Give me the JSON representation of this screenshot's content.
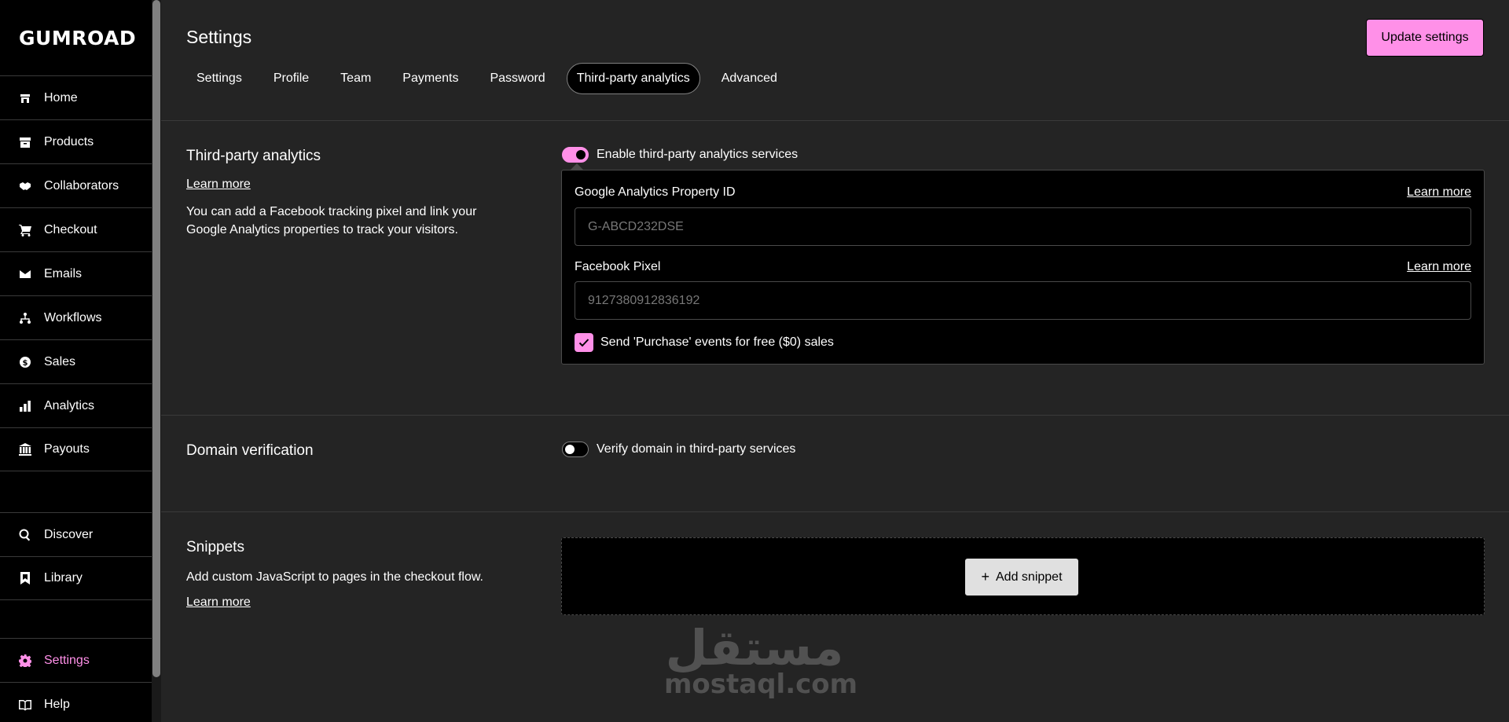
{
  "app": {
    "logo_text": "Gumroad"
  },
  "sidebar": {
    "items": [
      {
        "label": "Home",
        "icon": "home-icon"
      },
      {
        "label": "Products",
        "icon": "archive-icon"
      },
      {
        "label": "Collaborators",
        "icon": "handshake-icon"
      },
      {
        "label": "Checkout",
        "icon": "cart-icon"
      },
      {
        "label": "Emails",
        "icon": "envelope-icon"
      },
      {
        "label": "Workflows",
        "icon": "workflow-icon"
      },
      {
        "label": "Sales",
        "icon": "dollar-circle-icon"
      },
      {
        "label": "Analytics",
        "icon": "bar-chart-icon"
      },
      {
        "label": "Payouts",
        "icon": "bank-icon"
      },
      {
        "label": "Discover",
        "icon": "search-icon"
      },
      {
        "label": "Library",
        "icon": "bookmark-icon"
      },
      {
        "label": "Settings",
        "icon": "gear-icon",
        "active": true
      },
      {
        "label": "Help",
        "icon": "book-icon"
      }
    ]
  },
  "header": {
    "title": "Settings",
    "update_button": "Update settings",
    "tabs": [
      {
        "label": "Settings"
      },
      {
        "label": "Profile"
      },
      {
        "label": "Team"
      },
      {
        "label": "Payments"
      },
      {
        "label": "Password"
      },
      {
        "label": "Third-party analytics",
        "active": true
      },
      {
        "label": "Advanced"
      }
    ]
  },
  "analytics": {
    "title": "Third-party analytics",
    "learn_more": "Learn more",
    "description_line1": "You can add a Facebook tracking pixel and link your",
    "description_line2": "Google Analytics properties to track your visitors.",
    "toggle_label": "Enable third-party analytics services",
    "toggle_on": true,
    "ga_label": "Google Analytics Property ID",
    "ga_learn_more": "Learn more",
    "ga_placeholder": "G-ABCD232DSE",
    "fb_label": "Facebook Pixel",
    "fb_learn_more": "Learn more",
    "fb_placeholder": "9127380912836192",
    "checkbox_label": "Send 'Purchase' events for free ($0) sales",
    "checkbox_checked": true
  },
  "domain": {
    "title": "Domain verification",
    "toggle_label": "Verify domain in third-party services",
    "toggle_on": false
  },
  "snippets": {
    "title": "Snippets",
    "description": "Add custom JavaScript to pages in the checkout flow.",
    "learn_more": "Learn more",
    "add_button": "Add snippet"
  },
  "watermark": {
    "arabic": "مستقل",
    "latin": "mostaql.com"
  },
  "colors": {
    "accent": "#ff90e8",
    "background": "#242424",
    "sidebar": "#000000"
  }
}
